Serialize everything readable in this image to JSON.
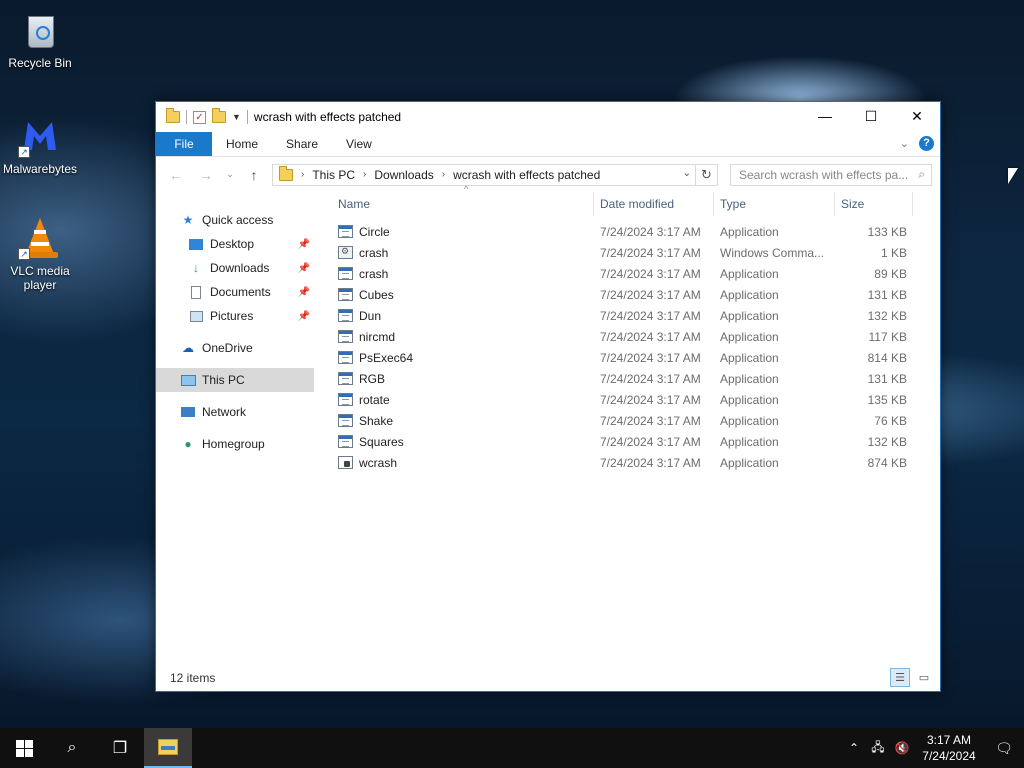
{
  "desktop": {
    "icons": [
      {
        "label": "Recycle Bin"
      },
      {
        "label": "Malwarebytes"
      },
      {
        "label": "VLC media player"
      }
    ]
  },
  "window": {
    "title": "wcrash with effects patched",
    "controls": {
      "minimize": "—",
      "maximize": "☐",
      "close": "✕"
    },
    "ribbon": {
      "tabs": [
        "File",
        "Home",
        "Share",
        "View"
      ],
      "help": "?"
    },
    "address": {
      "crumbs": [
        "This PC",
        "Downloads",
        "wcrash with effects patched"
      ],
      "refresh": "↻"
    },
    "search": {
      "placeholder": "Search wcrash with effects pa..."
    },
    "nav": {
      "items": [
        {
          "label": "Quick access",
          "icon": "star-icon"
        },
        {
          "label": "Desktop",
          "icon": "desktop-icon"
        },
        {
          "label": "Downloads",
          "icon": "download-icon"
        },
        {
          "label": "Documents",
          "icon": "document-icon"
        },
        {
          "label": "Pictures",
          "icon": "picture-icon"
        },
        {
          "label": "OneDrive",
          "icon": "cloud-icon"
        },
        {
          "label": "This PC",
          "icon": "computer-icon"
        },
        {
          "label": "Network",
          "icon": "network-icon"
        },
        {
          "label": "Homegroup",
          "icon": "homegroup-icon"
        }
      ]
    },
    "columns": {
      "name": "Name",
      "date": "Date modified",
      "type": "Type",
      "size": "Size"
    },
    "files": [
      {
        "name": "Circle",
        "date": "7/24/2024 3:17 AM",
        "type": "Application",
        "size": "133 KB"
      },
      {
        "name": "crash",
        "date": "7/24/2024 3:17 AM",
        "type": "Windows Comma...",
        "size": "1 KB"
      },
      {
        "name": "crash",
        "date": "7/24/2024 3:17 AM",
        "type": "Application",
        "size": "89 KB"
      },
      {
        "name": "Cubes",
        "date": "7/24/2024 3:17 AM",
        "type": "Application",
        "size": "131 KB"
      },
      {
        "name": "Dun",
        "date": "7/24/2024 3:17 AM",
        "type": "Application",
        "size": "132 KB"
      },
      {
        "name": "nircmd",
        "date": "7/24/2024 3:17 AM",
        "type": "Application",
        "size": "117 KB"
      },
      {
        "name": "PsExec64",
        "date": "7/24/2024 3:17 AM",
        "type": "Application",
        "size": "814 KB"
      },
      {
        "name": "RGB",
        "date": "7/24/2024 3:17 AM",
        "type": "Application",
        "size": "131 KB"
      },
      {
        "name": "rotate",
        "date": "7/24/2024 3:17 AM",
        "type": "Application",
        "size": "135 KB"
      },
      {
        "name": "Shake",
        "date": "7/24/2024 3:17 AM",
        "type": "Application",
        "size": "76 KB"
      },
      {
        "name": "Squares",
        "date": "7/24/2024 3:17 AM",
        "type": "Application",
        "size": "132 KB"
      },
      {
        "name": "wcrash",
        "date": "7/24/2024 3:17 AM",
        "type": "Application",
        "size": "874 KB"
      }
    ],
    "status": {
      "count": "12 items"
    }
  },
  "taskbar": {
    "clock": {
      "time": "3:17 AM",
      "date": "7/24/2024"
    }
  },
  "colors": {
    "accent": "#1979ca",
    "selection": "#d9d9d9"
  }
}
